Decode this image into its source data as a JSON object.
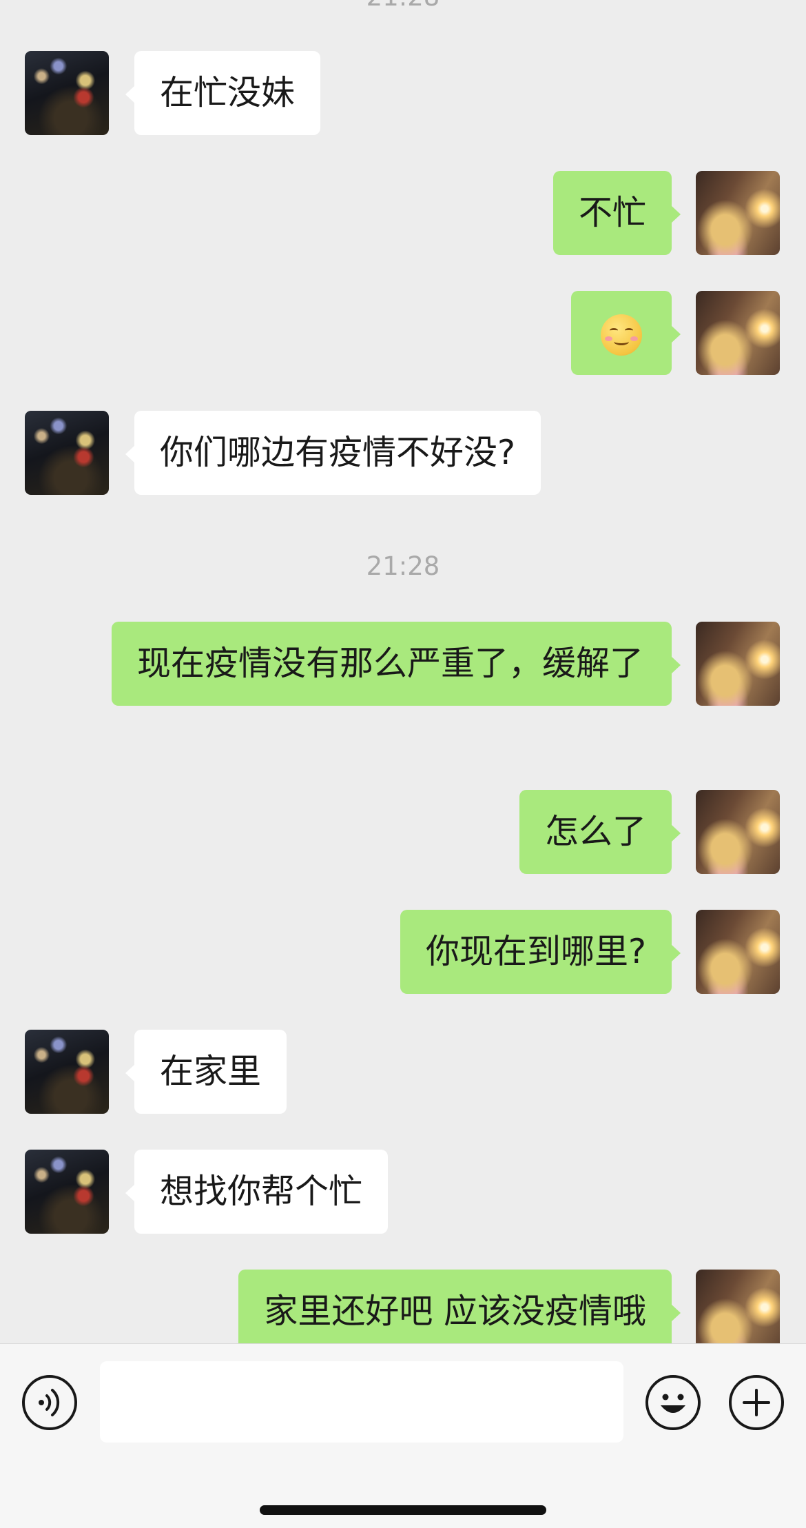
{
  "timestamps": {
    "top_partial": "21:28",
    "middle": "21:28"
  },
  "messages": [
    {
      "sender": "other",
      "text": "在忙没妹"
    },
    {
      "sender": "me",
      "text": "不忙"
    },
    {
      "sender": "me",
      "emoji": "smiling-face-emoji"
    },
    {
      "sender": "other",
      "text": "你们哪边有疫情不好没?"
    },
    {
      "sender": "me",
      "text": "现在疫情没有那么严重了，缓解了"
    },
    {
      "sender": "me",
      "text": "怎么了"
    },
    {
      "sender": "me",
      "text": "你现在到哪里?"
    },
    {
      "sender": "other",
      "text": "在家里"
    },
    {
      "sender": "other",
      "text": "想找你帮个忙"
    },
    {
      "sender": "me",
      "text": "家里还好吧 应该没疫情哦"
    }
  ],
  "input_bar": {
    "voice_icon": "voice-icon",
    "emoji_icon": "emoji-icon",
    "add_icon": "plus-icon",
    "input_value": ""
  },
  "colors": {
    "background": "#ededed",
    "my_bubble": "#a9e97d",
    "other_bubble": "#ffffff",
    "timestamp": "#a9a9a9"
  }
}
